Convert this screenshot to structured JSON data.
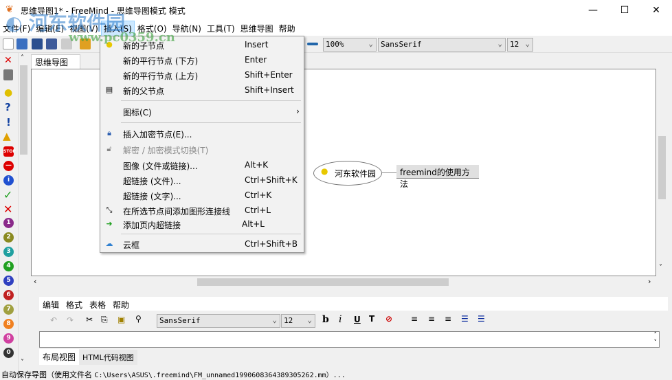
{
  "window": {
    "title": "思维导图1* - FreeMind - 思维导图模式 模式",
    "minimize": "—",
    "maximize": "☐",
    "close": "✕"
  },
  "menubar": [
    "文件(F)",
    "编辑(E)",
    "视图(V)",
    "插入(S)",
    "格式(O)",
    "导航(N)",
    "工具(T)",
    "思维导图",
    "帮助"
  ],
  "toolbar": {
    "zoom": "100%",
    "font": "SansSerif",
    "size": "12"
  },
  "tab": "思维导图1*",
  "insert_menu": [
    {
      "label": "新的子节点",
      "key": "Insert",
      "icon": "bulb-icon"
    },
    {
      "label": "新的平行节点 (下方)",
      "key": "Enter"
    },
    {
      "label": "新的平行节点 (上方)",
      "key": "Shift+Enter"
    },
    {
      "label": "新的父节点",
      "key": "Shift+Insert",
      "icon": "parent-node-icon"
    },
    {
      "label": "图标(C)",
      "key": "›",
      "submenu": true
    },
    {
      "label": "插入加密节点(E)...",
      "key": "",
      "icon": "lock-icon"
    },
    {
      "label": "解密 / 加密模式切换(T)",
      "key": "",
      "icon": "unlock-icon",
      "disabled": true
    },
    {
      "label": "图像 (文件或链接)...",
      "key": "Alt+K"
    },
    {
      "label": "超链接 (文件)...",
      "key": "Ctrl+Shift+K"
    },
    {
      "label": "超链接 (文字)...",
      "key": "Ctrl+K"
    },
    {
      "label": "在所选节点间添加图形连接线",
      "key": "Ctrl+L",
      "icon": "connector-icon"
    },
    {
      "label": "添加页内超链接",
      "key": "Alt+L",
      "icon": "arrow-icon"
    },
    {
      "label": "云框",
      "key": "Ctrl+Shift+B",
      "icon": "cloud-icon"
    }
  ],
  "map": {
    "root": "河东软件园",
    "child": "freemind的使用方法"
  },
  "editor": {
    "menu": [
      "编辑",
      "格式",
      "表格",
      "帮助"
    ],
    "font": "SansSerif",
    "size": "12",
    "tabs": [
      "布局视图",
      "HTML代码视图"
    ]
  },
  "status": {
    "prefix": "自动保存导图（使用文件名",
    "path": "C:\\Users\\ASUS\\.freemind\\FM_unnamed1990608364389305262.mm）..."
  },
  "watermark": {
    "text": "河东软件园",
    "url": "www.pc0359.cn"
  },
  "left_icons": [
    "delete",
    "trash",
    "idea",
    "help",
    "important",
    "warning",
    "stop",
    "no",
    "info",
    "ok",
    "cancel",
    "1",
    "2",
    "3",
    "4",
    "5",
    "6",
    "7",
    "8",
    "9",
    "0"
  ]
}
